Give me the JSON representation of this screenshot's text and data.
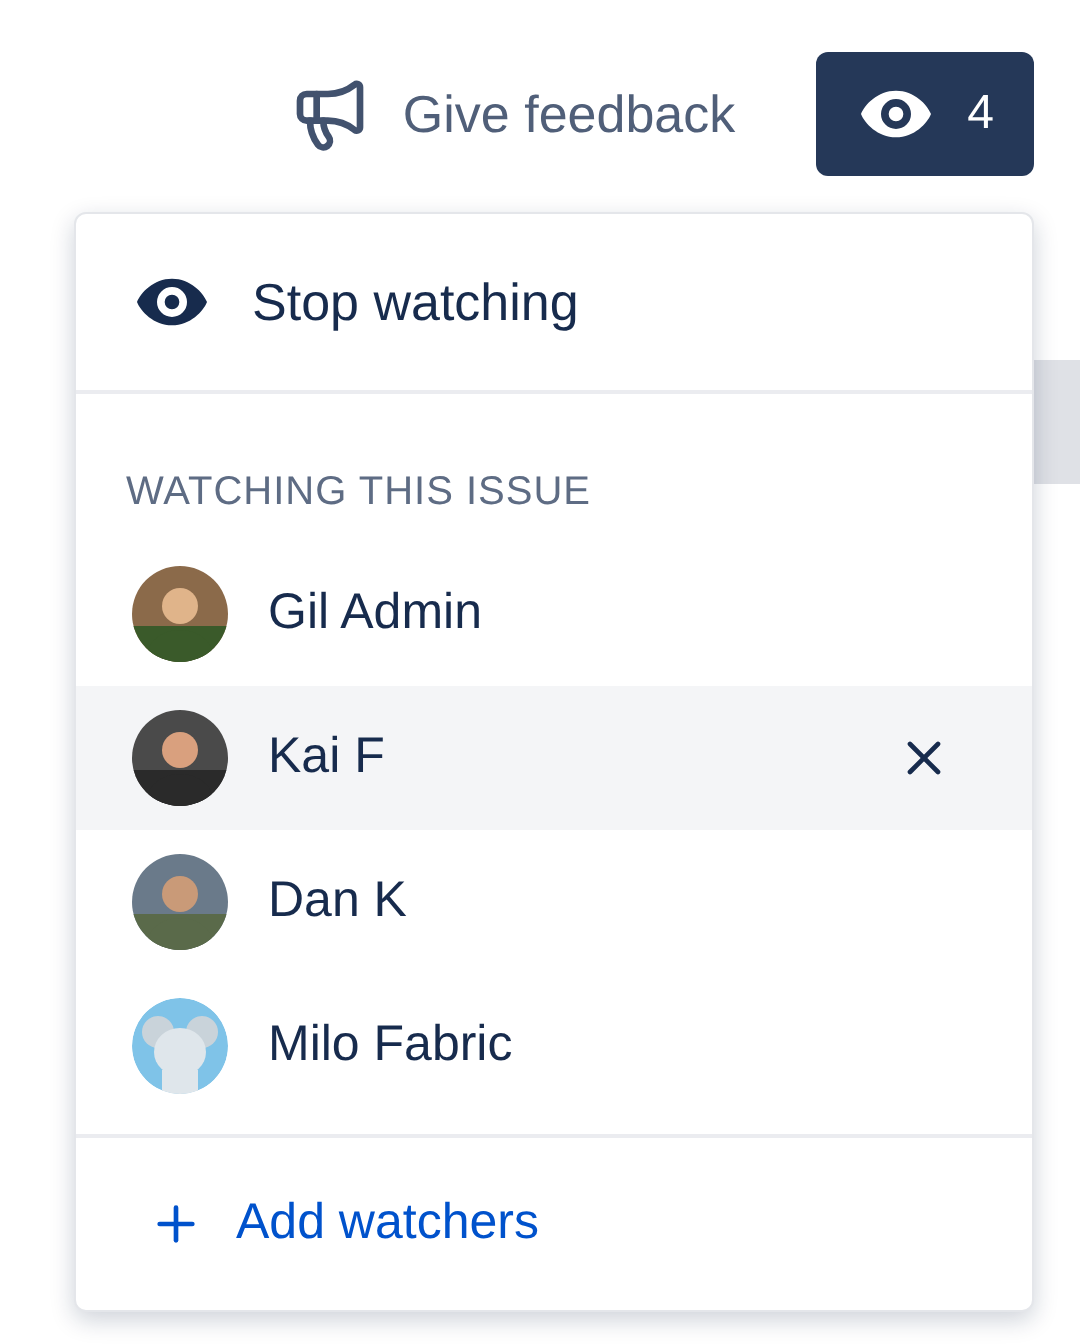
{
  "header": {
    "feedback_label": "Give feedback",
    "watch_count": "4"
  },
  "menu": {
    "stop_label": "Stop watching",
    "section_title": "WATCHING THIS ISSUE",
    "watchers": [
      {
        "name": "Gil Admin",
        "selected": false
      },
      {
        "name": "Kai F",
        "selected": true
      },
      {
        "name": "Dan K",
        "selected": false
      },
      {
        "name": "Milo Fabric",
        "selected": false,
        "kind": "illustration"
      }
    ],
    "add_label": "Add watchers"
  }
}
